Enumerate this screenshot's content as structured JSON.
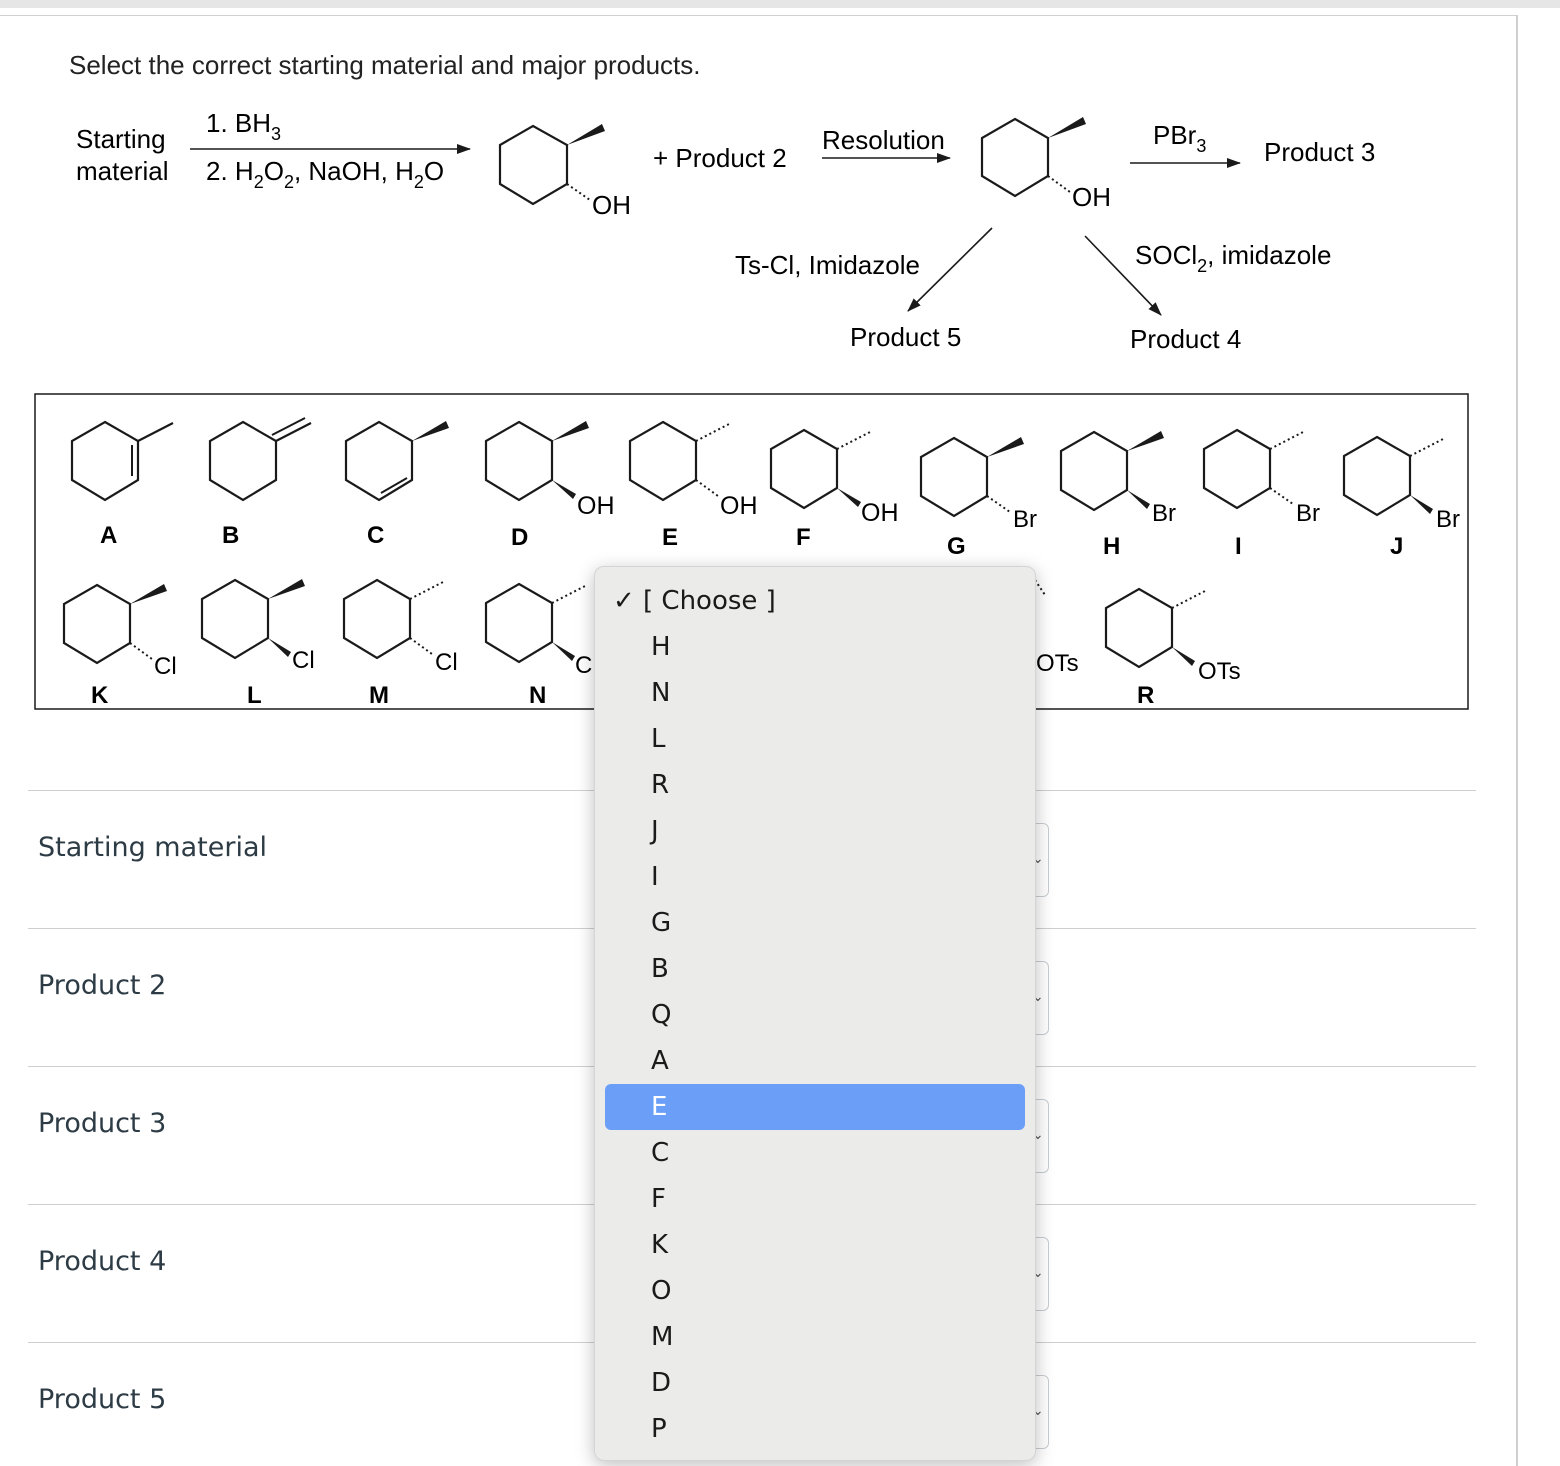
{
  "question": {
    "prompt": "Select the correct starting material and major products."
  },
  "scheme": {
    "starting_material": [
      "Starting",
      "material"
    ],
    "step1": "1. BH",
    "step1_sub": "3",
    "step2_parts": [
      "2. H",
      "2",
      "O",
      "2",
      ", NaOH, H",
      "2",
      "O"
    ],
    "product1_oh": "OH",
    "plus_product2": "+ Product 2",
    "resolution": "Resolution",
    "resolved_oh": "OH",
    "pbr3": "PBr",
    "pbr3_sub": "3",
    "product3": "Product 3",
    "tscl": "Ts-Cl, Imidazole",
    "socl2": "SOCl",
    "socl2_sub": "2",
    "socl2_rest": ", imidazole",
    "product5": "Product 5",
    "product4": "Product 4"
  },
  "choices": [
    {
      "letter": "A",
      "group": ""
    },
    {
      "letter": "B",
      "group": ""
    },
    {
      "letter": "C",
      "group": ""
    },
    {
      "letter": "D",
      "group": "OH"
    },
    {
      "letter": "E",
      "group": "OH"
    },
    {
      "letter": "F",
      "group": "OH"
    },
    {
      "letter": "G",
      "group": "Br"
    },
    {
      "letter": "H",
      "group": "Br"
    },
    {
      "letter": "I",
      "group": "Br"
    },
    {
      "letter": "J",
      "group": "Br"
    },
    {
      "letter": "K",
      "group": "Cl"
    },
    {
      "letter": "L",
      "group": "Cl"
    },
    {
      "letter": "M",
      "group": "Cl"
    },
    {
      "letter": "N",
      "group": "C"
    },
    {
      "letter": "",
      "group": "OTs"
    },
    {
      "letter": "R",
      "group": "OTs"
    }
  ],
  "answer_rows": [
    {
      "label": "Starting material"
    },
    {
      "label": "Product 2"
    },
    {
      "label": "Product 3"
    },
    {
      "label": "Product 4"
    },
    {
      "label": "Product 5"
    }
  ],
  "dropdown": {
    "check": "✓",
    "options": [
      "[ Choose ]",
      "H",
      "N",
      "L",
      "R",
      "J",
      "I",
      "G",
      "B",
      "Q",
      "A",
      "E",
      "C",
      "F",
      "K",
      "O",
      "M",
      "D",
      "P"
    ],
    "highlighted": "E",
    "highlight_color": "#6a9ef7"
  },
  "select_caret": "⌄"
}
